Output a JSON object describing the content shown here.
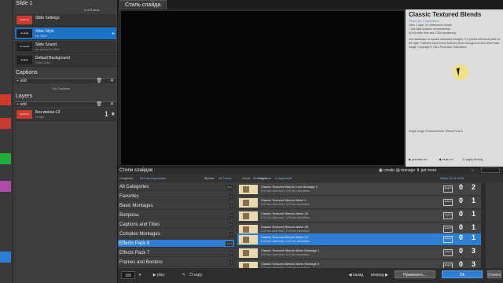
{
  "left": {
    "slide_header": "Slide 1",
    "counter": "0 of 5 secs",
    "rows": [
      {
        "thumb": "bunch of",
        "title": "Slide Settings",
        "sub": ""
      },
      {
        "thumb": "no style",
        "title": "Slide Style",
        "sub": "No Style"
      },
      {
        "thumb": "no sound",
        "title": "Slide Sound",
        "sub": "No sound in slide"
      },
      {
        "thumb": "default",
        "title": "Default Background",
        "sub": "Solid Color"
      }
    ],
    "captions_header": "Captions",
    "add_label": "add",
    "no_captions": "No Captions",
    "layers_header": "Layers",
    "layer": {
      "thumb": "bunch of",
      "title": "Без имени-13",
      "sub": "Image",
      "num": "1"
    }
  },
  "preview": {
    "tab": "Стиль слайда",
    "title": "Classic Textured Blends",
    "company": "Photodex Corporation",
    "desc1": "Uses 1 layer, for widescreen shows",
    "desc2": "7.00s total duration recommended",
    "desc3": "(5.00s slide time and 2.00s transitions)",
    "desc4": "Use landscape or square-orientation images. For photos with focal point on the right. Features warm-toned textured photo background and offset main image. Copyright © 2014 Photodex Corporation",
    "desc5": "Single Image Enhancements, Effects Pack 6",
    "preview_on": "preview on",
    "mute_on": "mute on",
    "apply_timing": "apply timing"
  },
  "styles": {
    "header": "Стили слайдов",
    "create": "create",
    "manage": "manage",
    "get_more": "get more",
    "filter_side_label": "Стороны:",
    "filter_side": "Все пропорциями",
    "filter_time_label": "Время:",
    "filter_time": "All Times",
    "filter_layers_label": "Слои:",
    "filter_layers": "Все слои",
    "filter_caps_label": "Надписи:",
    "filter_caps": "0 надписей",
    "count_info": "Show 16 of 1234",
    "categories": [
      {
        "name": "All Categories",
        "count": "1234"
      },
      {
        "name": "Favorites",
        "count": "0"
      },
      {
        "name": "Basic Montages",
        "count": "4"
      },
      {
        "name": "Вопросы",
        "count": "3"
      },
      {
        "name": "Captions and Titles",
        "count": "5"
      },
      {
        "name": "Complex Montages",
        "count": "1"
      },
      {
        "name": "Effects Pack 6",
        "count": "1993"
      },
      {
        "name": "Effects Pack 7",
        "count": "8"
      },
      {
        "name": "Frames and Borders",
        "count": "4"
      }
    ],
    "items": [
      {
        "name": "Classic Textured Blends Cool Montage 2",
        "dur": "5.00 sec slide time | 2.00 sec transitions",
        "a": "0",
        "b": "2"
      },
      {
        "name": "Classic Textured Blends Warm 1",
        "dur": "5.00 sec slide time | 2.00 sec transitions",
        "a": "0",
        "b": "1"
      },
      {
        "name": "Classic Textured Blends Warm 2A",
        "dur": "5.00 sec slide time | 2.00 sec transitions",
        "a": "0",
        "b": "1"
      },
      {
        "name": "Classic Textured Blends Warm 2B",
        "dur": "5.00 sec slide time | 2.00 sec transitions",
        "a": "0",
        "b": "1"
      },
      {
        "name": "Classic Textured Blends Warm 2C",
        "dur": "5.00 sec slide time | 2.00 sec transitions",
        "a": "0",
        "b": "1"
      },
      {
        "name": "Classic Textured Blends Warm Montage 1",
        "dur": "5.00 sec slide time | 2.00 sec transitions",
        "a": "0",
        "b": "3"
      },
      {
        "name": "Classic Textured Blends Warm Montage 2",
        "dur": "5.00 sec slide time | 2.00 sec transitions",
        "a": "0",
        "b": "3"
      }
    ],
    "aspect_label": "aspect",
    "captions_label": "captions",
    "layers_label": "layers"
  },
  "bottom": {
    "zoom": "100",
    "play": "play",
    "copy": "copy",
    "back": "назад",
    "fwd": "вперед",
    "apply": "Применить...",
    "ok": "Ok",
    "cancel": "Отмена"
  }
}
